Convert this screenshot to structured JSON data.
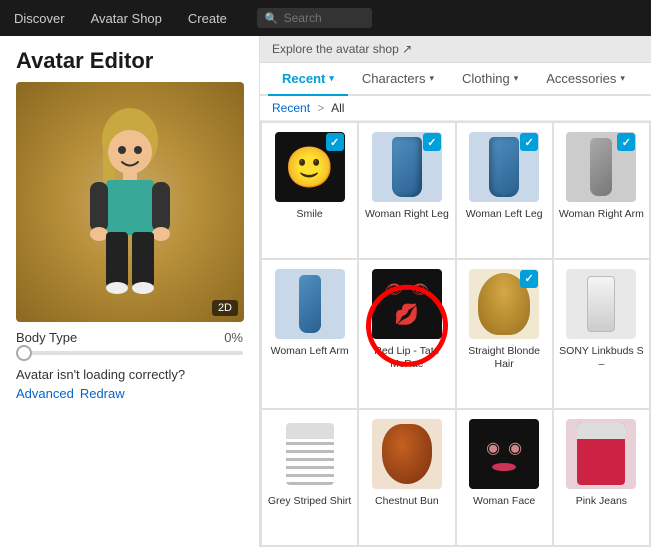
{
  "topNav": {
    "items": [
      "Discover",
      "Avatar Shop",
      "Create"
    ],
    "searchPlaceholder": "Search"
  },
  "leftPanel": {
    "title": "Avatar Editor",
    "badge2D": "2D",
    "bodyType": {
      "label": "Body Type",
      "percent": "0%",
      "fullLabel": "Body Type 096"
    },
    "loadingText": "Avatar isn't loading correctly?",
    "links": [
      "Advanced",
      "Redraw"
    ],
    "exploreText": "Explore the avatar shop ↗"
  },
  "tabs": [
    {
      "id": "recent",
      "label": "Recent",
      "active": true
    },
    {
      "id": "characters",
      "label": "Characters",
      "active": false
    },
    {
      "id": "clothing",
      "label": "Clothing",
      "active": false
    },
    {
      "id": "accessories",
      "label": "Accessories",
      "active": false
    }
  ],
  "breadcrumb": {
    "parent": "Recent",
    "separator": ">",
    "current": "All"
  },
  "items": [
    {
      "id": "smile",
      "label": "Smile",
      "type": "smile",
      "checked": true
    },
    {
      "id": "woman-right-leg",
      "label": "Woman Right Leg",
      "type": "teal-leg",
      "checked": true
    },
    {
      "id": "woman-left-leg",
      "label": "Woman Left Leg",
      "type": "teal-leg2",
      "checked": true
    },
    {
      "id": "woman-right-arm",
      "label": "Woman Right Arm",
      "type": "grey-arm",
      "checked": true
    },
    {
      "id": "woman-left-arm",
      "label": "Woman Left Arm",
      "type": "blue-arm",
      "checked": false
    },
    {
      "id": "red-lip",
      "label": "Red Lip - Tate McRae",
      "type": "red-lip-face",
      "checked": false,
      "redCircle": true
    },
    {
      "id": "straight-blonde",
      "label": "Straight Blonde Hair",
      "type": "blonde-hair",
      "checked": true
    },
    {
      "id": "sony-linkbuds",
      "label": "SONY Linkbuds S –",
      "type": "earbuds",
      "checked": false
    },
    {
      "id": "grey-striped",
      "label": "Grey Striped Shirt",
      "type": "grey-striped",
      "checked": false
    },
    {
      "id": "chestnut-bun",
      "label": "Chestnut Bun",
      "type": "chestnut-hair",
      "checked": false
    },
    {
      "id": "woman-face",
      "label": "Woman Face",
      "type": "woman-face",
      "checked": false
    },
    {
      "id": "pink-jeans",
      "label": "Pink Jeans",
      "type": "pink-jeans",
      "checked": false
    }
  ]
}
